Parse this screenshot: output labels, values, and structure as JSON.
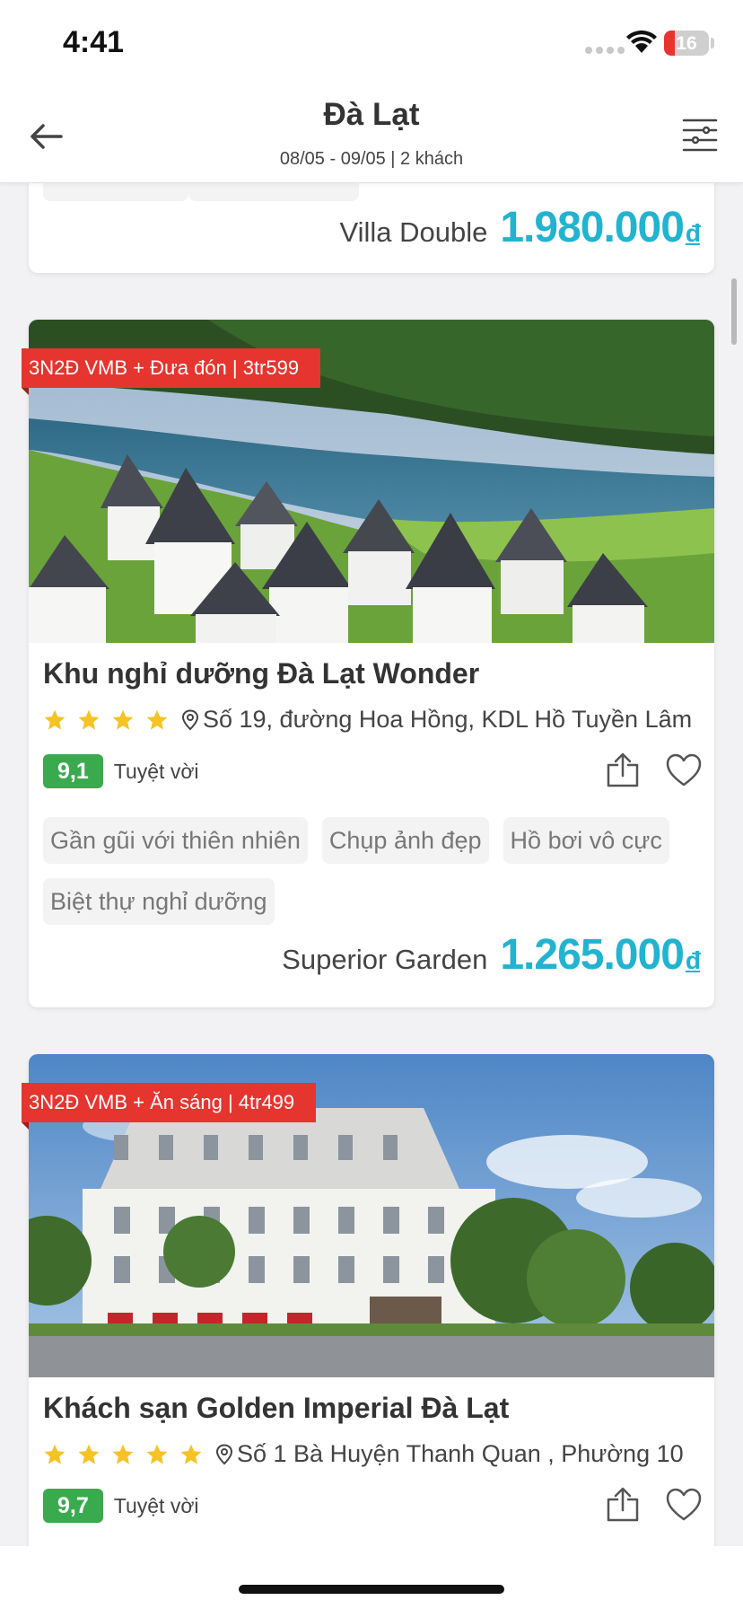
{
  "status_bar": {
    "time": "4:41",
    "battery": "16"
  },
  "header": {
    "title": "Đà Lạt",
    "subtitle": "08/05 - 09/05 | 2 khách"
  },
  "previous_card": {
    "room": "Villa Double",
    "price": "1.980.000",
    "currency": "đ"
  },
  "hotels": [
    {
      "promo": "3N2Đ VMB + Đưa đón | 3tr599",
      "name": "Khu nghỉ dưỡng Đà Lạt Wonder",
      "stars": 4,
      "address": "Số 19, đường Hoa Hồng, KDL Hồ Tuyền Lâm",
      "score": "9,1",
      "rating_text": "Tuyệt vời",
      "tags": [
        "Gần gũi với thiên nhiên",
        "Chụp ảnh đẹp",
        "Hồ bơi vô cực",
        "Biệt thự nghỉ dưỡng"
      ],
      "room": "Superior Garden",
      "price": "1.265.000",
      "currency": "đ"
    },
    {
      "promo": "3N2Đ VMB + Ăn sáng | 4tr499",
      "name": "Khách sạn Golden Imperial Đà Lạt",
      "stars": 5,
      "address": "Số 1 Bà Huyện Thanh Quan , Phường 10",
      "score": "9,7",
      "rating_text": "Tuyệt vời"
    }
  ],
  "colors": {
    "price": "#22b3d0",
    "promo": "#e5352e",
    "score": "#3aaa4e",
    "star": "#f5c324"
  },
  "icons": [
    "back-arrow-icon",
    "filter-icon",
    "location-pin-icon",
    "star-icon",
    "share-icon",
    "heart-icon",
    "wifi-icon"
  ]
}
